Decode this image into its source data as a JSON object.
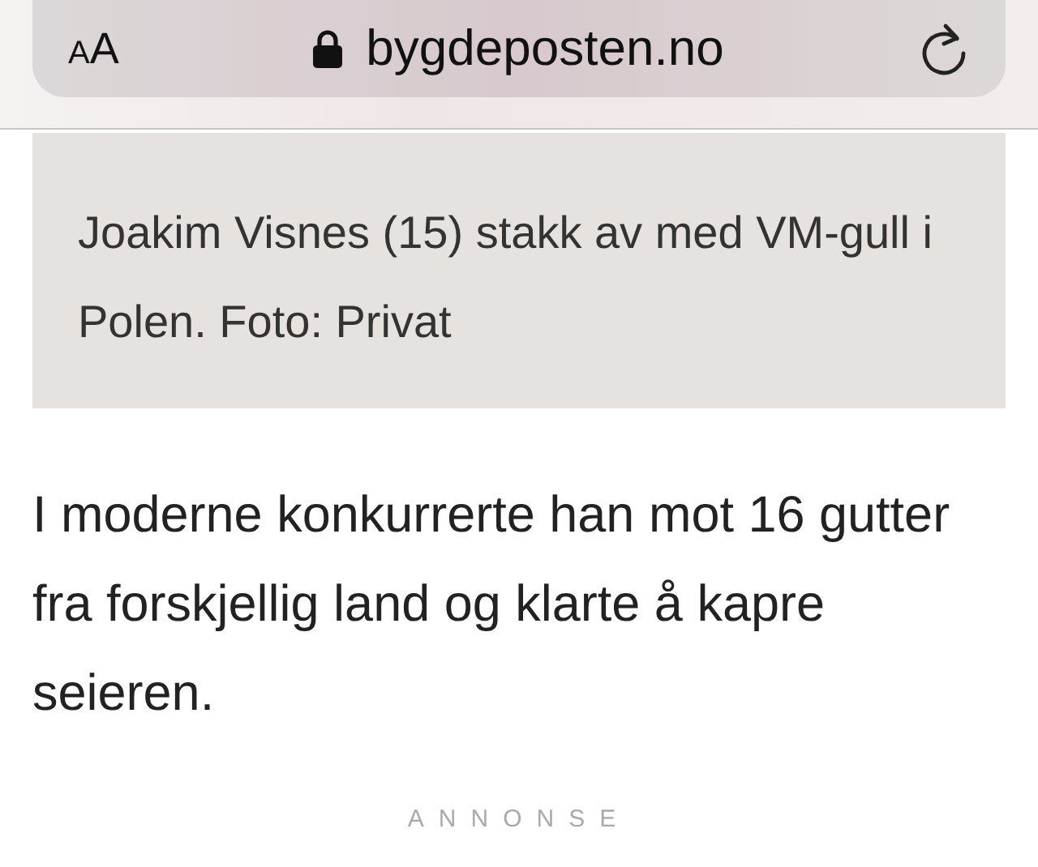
{
  "browser_bar": {
    "text_size_button": "AA",
    "url": "bygdeposten.no"
  },
  "caption": "Joakim Visnes (15) stakk av med VM-gull i Polen. Foto: Privat",
  "paragraph": "I moderne konkurrerte han mot 16 gutter fra forskjellig land og klarte å kapre seieren.",
  "ad_label": "ANNONSE"
}
